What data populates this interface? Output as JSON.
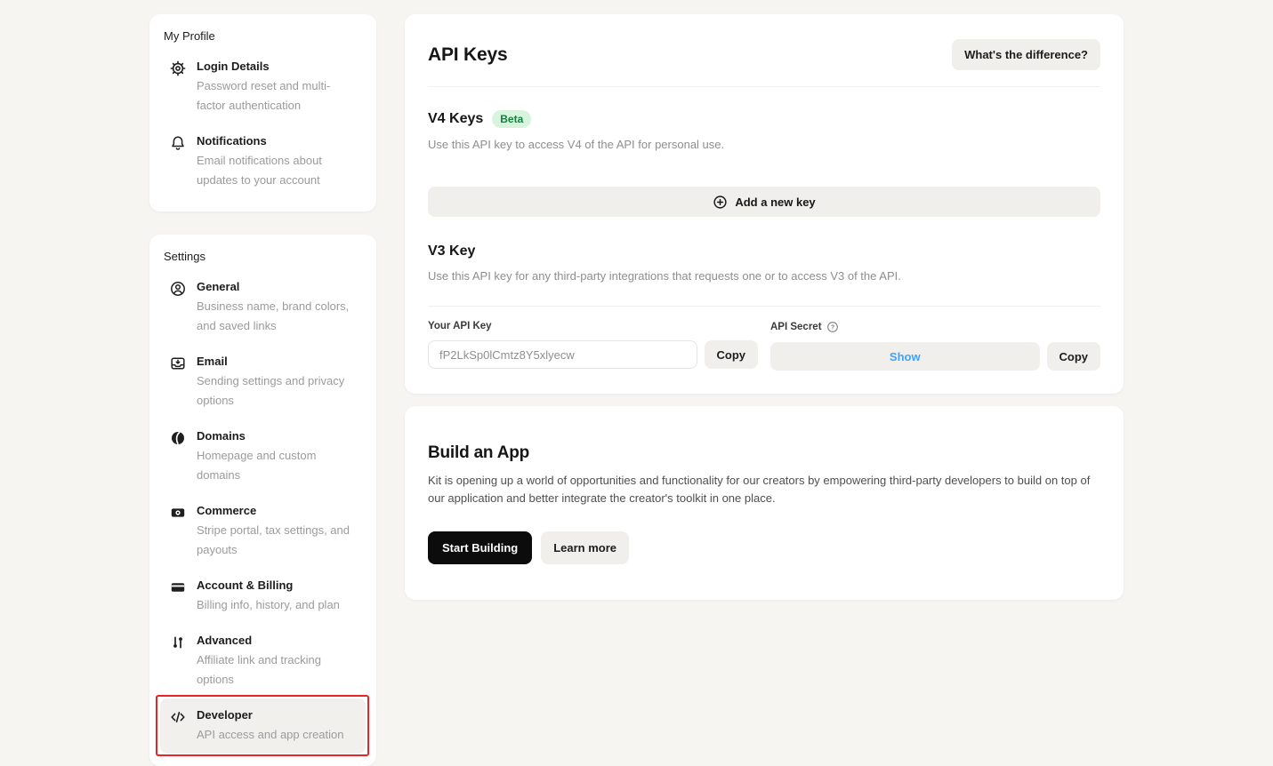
{
  "sidebar": {
    "profile": {
      "label": "My Profile",
      "items": [
        {
          "icon": "gear-icon",
          "title": "Login Details",
          "desc": "Password reset and multi-factor authentication"
        },
        {
          "icon": "bell-icon",
          "title": "Notifications",
          "desc": "Email notifications about updates to your account"
        }
      ]
    },
    "settings": {
      "label": "Settings",
      "items": [
        {
          "icon": "user-circle-icon",
          "title": "General",
          "desc": "Business name, brand colors, and saved links"
        },
        {
          "icon": "inbox-icon",
          "title": "Email",
          "desc": "Sending settings and privacy options"
        },
        {
          "icon": "globe-icon",
          "title": "Domains",
          "desc": "Homepage and custom domains"
        },
        {
          "icon": "banknote-icon",
          "title": "Commerce",
          "desc": "Stripe portal, tax settings, and payouts"
        },
        {
          "icon": "credit-card-icon",
          "title": "Account & Billing",
          "desc": "Billing info, history, and plan"
        },
        {
          "icon": "toggles-icon",
          "title": "Advanced",
          "desc": "Affiliate link and tracking options"
        },
        {
          "icon": "code-icon",
          "title": "Developer",
          "desc": "API access and app creation"
        }
      ]
    }
  },
  "api_keys": {
    "title": "API Keys",
    "difference_button": "What's the difference?",
    "v4": {
      "title": "V4 Keys",
      "badge": "Beta",
      "description": "Use this API key to access V4 of the API for personal use.",
      "add_button": "Add a new key"
    },
    "v3": {
      "title": "V3 Key",
      "description": "Use this API key for any third-party integrations that requests one or to access V3 of the API.",
      "api_key_label": "Your API Key",
      "api_key_value": "fP2LkSp0lCmtz8Y5xlyecw",
      "copy_label": "Copy",
      "secret_label": "API Secret",
      "show_label": "Show",
      "secret_copy_label": "Copy"
    }
  },
  "build_app": {
    "title": "Build an App",
    "description": "Kit is opening up a world of opportunities and functionality for our creators by empowering third-party developers to build on top of our application and better integrate the creator's toolkit in one place.",
    "start_button": "Start Building",
    "learn_button": "Learn more"
  },
  "colors": {
    "background": "#f7f5f2",
    "accent_blue": "#41a2fd",
    "beta_badge_bg": "#d7f5dd",
    "beta_badge_text": "#157f3e",
    "annotation_red": "#ea2424",
    "button_black": "#0c0c0c"
  }
}
